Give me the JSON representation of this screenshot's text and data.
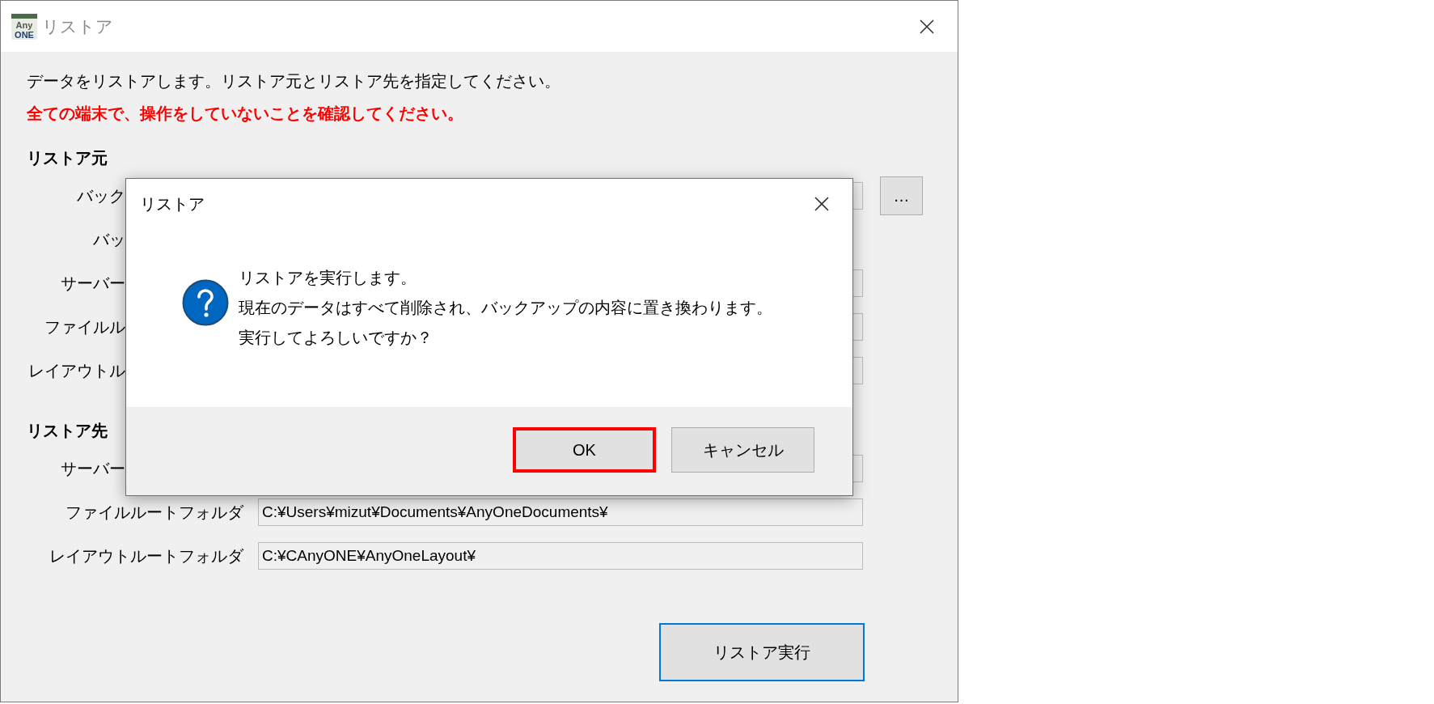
{
  "window": {
    "title": "リストア",
    "app_icon": {
      "top": "Any",
      "bottom": "ONE"
    }
  },
  "intro": "データをリストアします。リストア元とリストア先を指定してください。",
  "warning": "全ての端末で、操作をしていないことを確認してください。",
  "sections": [
    {
      "heading": "リストア元",
      "rows": [
        {
          "kind": "covered_field",
          "label": "バック",
          "browse": "…"
        },
        {
          "kind": "covered_label",
          "label": "バッ"
        },
        {
          "kind": "covered_field",
          "label": "サーバー"
        },
        {
          "kind": "covered_field",
          "label": "ファイルル"
        },
        {
          "kind": "covered_field",
          "label": "レイアウトル"
        }
      ]
    },
    {
      "heading": "リストア先",
      "rows": [
        {
          "kind": "covered_field",
          "label": "サーバー"
        },
        {
          "kind": "field",
          "label": "ファイルルートフォルダ",
          "value": "C:¥Users¥mizut¥Documents¥AnyOneDocuments¥"
        },
        {
          "kind": "field",
          "label": "レイアウトルートフォルダ",
          "value": "C:¥CAnyONE¥AnyOneLayout¥"
        }
      ]
    }
  ],
  "execute_button": {
    "label": "リストア実行",
    "focused": true
  },
  "dialog": {
    "title": "リストア",
    "lines": [
      "リストアを実行します。",
      "現在のデータはすべて削除され、バックアップの内容に置き換わります。",
      "実行してよろしいですか？"
    ],
    "buttons": [
      {
        "label": "OK",
        "highlighted": true
      },
      {
        "label": "キャンセル",
        "highlighted": false
      }
    ]
  }
}
